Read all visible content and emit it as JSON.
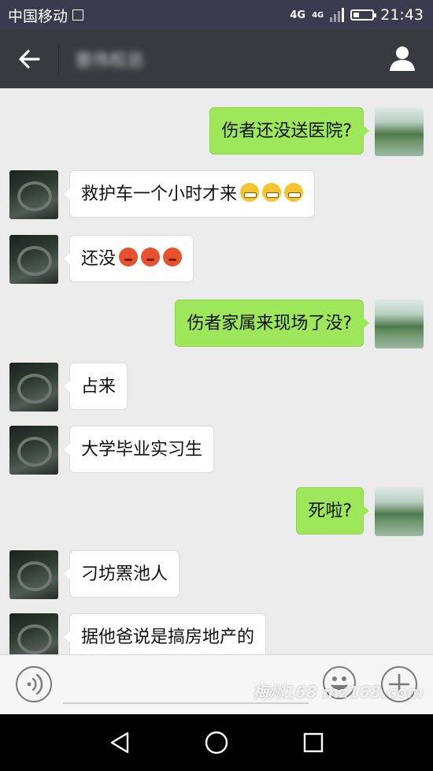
{
  "status_bar": {
    "carrier": "中国移动",
    "network": "4G",
    "network_secondary": "4G",
    "time": "21:43",
    "battery_level": 0.3
  },
  "header": {
    "back_icon": "arrow-left-icon",
    "title": "曾伟权总",
    "profile_icon": "person-icon"
  },
  "messages": [
    {
      "sender": "self",
      "text": "伤者还没送医院?",
      "emojis": []
    },
    {
      "sender": "other",
      "text": "救护车一个小时才来",
      "emojis": [
        "grin",
        "grin",
        "grin"
      ]
    },
    {
      "sender": "other",
      "text": "还没",
      "emojis": [
        "angry",
        "angry",
        "angry"
      ]
    },
    {
      "sender": "self",
      "text": "伤者家属来现场了没?",
      "emojis": []
    },
    {
      "sender": "other",
      "text": "占来",
      "emojis": []
    },
    {
      "sender": "other",
      "text": "大学毕业实习生",
      "emojis": []
    },
    {
      "sender": "self",
      "text": "死啦?",
      "emojis": []
    },
    {
      "sender": "other",
      "text": "刁坊罴池人",
      "emojis": []
    },
    {
      "sender": "other",
      "text": "据他爸说是搞房地产的",
      "emojis": []
    }
  ],
  "input_bar": {
    "voice_icon": "voice-icon",
    "text_value": "",
    "emoji_icon": "smiley-icon",
    "plus_icon": "plus-icon"
  },
  "watermark": "梅州168 mz168.com",
  "nav_bar": {
    "back_icon": "triangle-back-icon",
    "home_icon": "circle-home-icon",
    "recents_icon": "square-recents-icon"
  }
}
